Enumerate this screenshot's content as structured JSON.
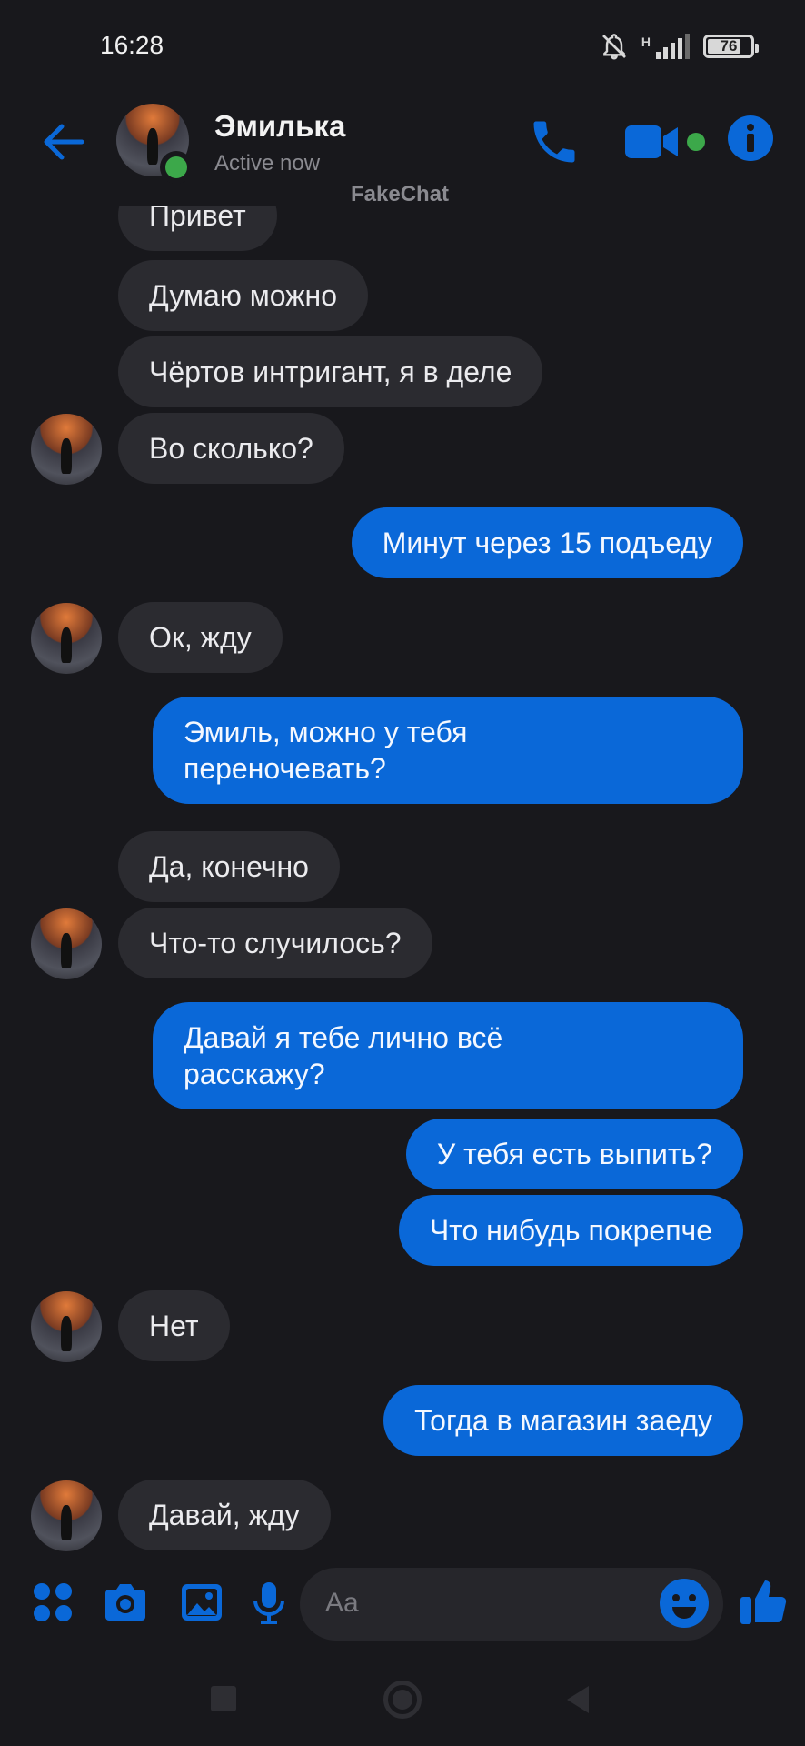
{
  "status_bar": {
    "time": "16:28",
    "network_label": "H",
    "battery": "76",
    "icons": [
      "bell-off-icon",
      "signal-icon",
      "battery-icon"
    ]
  },
  "header": {
    "contact_name": "Эмилька",
    "contact_status": "Active now",
    "watermark": "FakeChat",
    "icons": [
      "back-arrow-icon",
      "phone-icon",
      "video-camera-icon",
      "info-icon"
    ]
  },
  "colors": {
    "accent": "#0a68d8",
    "background": "#18181c",
    "incoming_bubble": "#2b2b30",
    "online": "#3ca84a"
  },
  "messages": [
    {
      "dir": "in",
      "text": "Привет"
    },
    {
      "dir": "in",
      "text": "Думаю можно"
    },
    {
      "dir": "in",
      "text": "Чёртов интригант, я в деле"
    },
    {
      "dir": "in",
      "text": "Во сколько?"
    },
    {
      "dir": "out",
      "text": "Минут через 15 подъеду"
    },
    {
      "dir": "in",
      "text": "Ок, жду"
    },
    {
      "dir": "out",
      "text": "Эмиль, можно у тебя\nпереночевать?"
    },
    {
      "dir": "in",
      "text": "Да, конечно"
    },
    {
      "dir": "in",
      "text": "Что-то случилось?"
    },
    {
      "dir": "out",
      "text": "Давай я тебе лично всё\nрасскажу?"
    },
    {
      "dir": "out",
      "text": "У тебя есть выпить?"
    },
    {
      "dir": "out",
      "text": "Что нибудь покрепче"
    },
    {
      "dir": "in",
      "text": "Нет"
    },
    {
      "dir": "out",
      "text": "Тогда в магазин заеду"
    },
    {
      "dir": "in",
      "text": "Давай, жду"
    }
  ],
  "composer": {
    "placeholder": "Aa",
    "icons": [
      "apps-grid-icon",
      "camera-icon",
      "gallery-icon",
      "microphone-icon",
      "emoji-icon",
      "thumbs-up-icon"
    ]
  },
  "nav_bar": {
    "icons": [
      "recents-square-icon",
      "home-circle-icon",
      "back-triangle-icon"
    ]
  }
}
